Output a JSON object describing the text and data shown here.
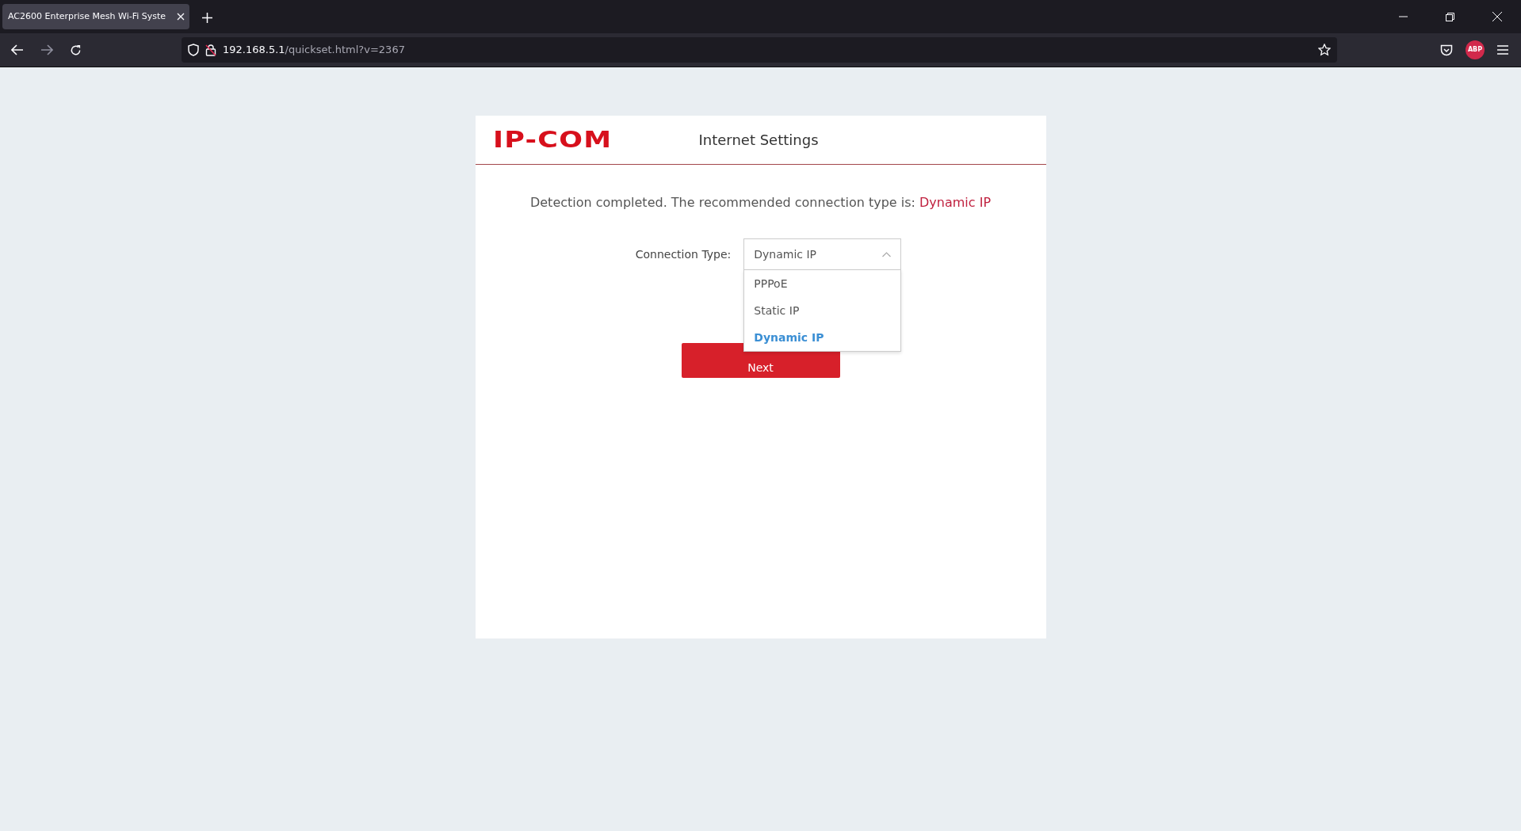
{
  "browser": {
    "tab_title": "AC2600 Enterprise Mesh Wi-Fi Syste",
    "url_host": "192.168.5.1",
    "url_path": "/quickset.html?v=2367",
    "extension_badge": "ABP"
  },
  "card": {
    "logo": "IP-COM",
    "title": "Internet Settings",
    "message": "Detection completed. The recommended connection type is:",
    "recommended": "Dynamic IP",
    "field_label": "Connection Type:",
    "select": {
      "value": "Dynamic IP",
      "expanded": true,
      "options": [
        {
          "label": "PPPoE",
          "selected": false
        },
        {
          "label": "Static IP",
          "selected": false
        },
        {
          "label": "Dynamic IP",
          "selected": true
        }
      ]
    },
    "button": "Next"
  }
}
